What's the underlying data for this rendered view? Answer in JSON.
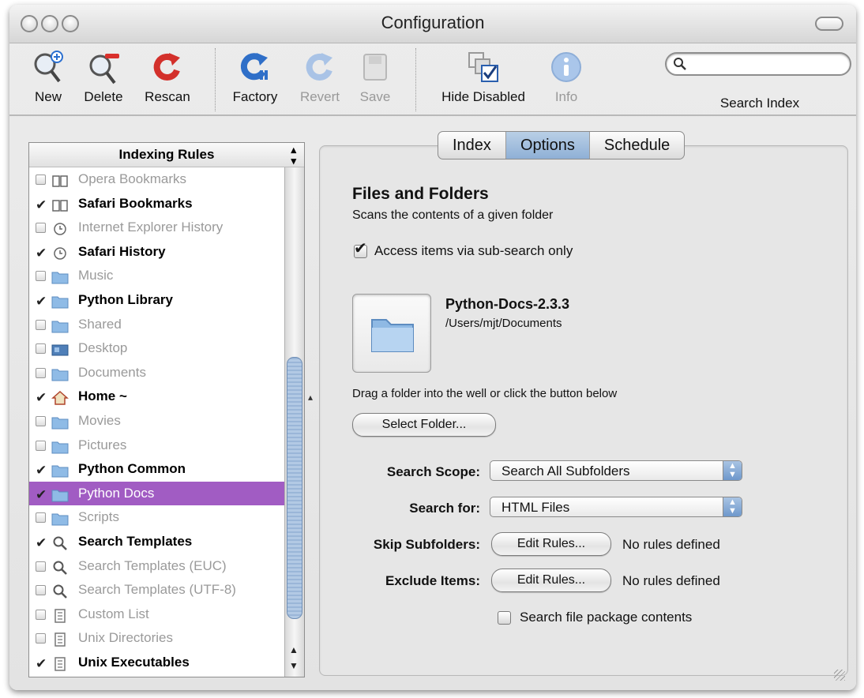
{
  "window": {
    "title": "Configuration"
  },
  "toolbar": {
    "new_label": "New",
    "delete_label": "Delete",
    "rescan_label": "Rescan",
    "factory_label": "Factory",
    "revert_label": "Revert",
    "save_label": "Save",
    "hide_disabled_label": "Hide Disabled",
    "info_label": "Info",
    "search_label": "Search Index",
    "search_value": ""
  },
  "sidebar": {
    "header": "Indexing Rules",
    "items": [
      {
        "label": "Opera Bookmarks",
        "checked": false,
        "icon": "book-icon"
      },
      {
        "label": "Safari Bookmarks",
        "checked": true,
        "icon": "book-icon"
      },
      {
        "label": "Internet Explorer History",
        "checked": false,
        "icon": "clock-icon"
      },
      {
        "label": "Safari History",
        "checked": true,
        "icon": "clock-icon"
      },
      {
        "label": "Music",
        "checked": false,
        "icon": "folder-icon"
      },
      {
        "label": "Python Library",
        "checked": true,
        "icon": "folder-icon"
      },
      {
        "label": "Shared",
        "checked": false,
        "icon": "folder-icon"
      },
      {
        "label": "Desktop",
        "checked": false,
        "icon": "desktop-icon"
      },
      {
        "label": "Documents",
        "checked": false,
        "icon": "folder-icon"
      },
      {
        "label": "Home ~",
        "checked": true,
        "icon": "home-icon"
      },
      {
        "label": "Movies",
        "checked": false,
        "icon": "folder-icon"
      },
      {
        "label": "Pictures",
        "checked": false,
        "icon": "folder-icon"
      },
      {
        "label": "Python Common",
        "checked": true,
        "icon": "folder-icon"
      },
      {
        "label": "Python Docs",
        "checked": true,
        "icon": "folder-icon",
        "selected": true
      },
      {
        "label": "Scripts",
        "checked": false,
        "icon": "folder-icon"
      },
      {
        "label": "Search Templates",
        "checked": true,
        "icon": "magnifier-icon"
      },
      {
        "label": "Search Templates (EUC)",
        "checked": false,
        "icon": "magnifier-icon"
      },
      {
        "label": "Search Templates (UTF-8)",
        "checked": false,
        "icon": "magnifier-icon"
      },
      {
        "label": "Custom List",
        "checked": false,
        "icon": "list-icon"
      },
      {
        "label": "Unix Directories",
        "checked": false,
        "icon": "list-icon"
      },
      {
        "label": "Unix Executables",
        "checked": true,
        "icon": "list-icon"
      }
    ]
  },
  "tabs": [
    {
      "label": "Index",
      "active": false
    },
    {
      "label": "Options",
      "active": true
    },
    {
      "label": "Schedule",
      "active": false
    }
  ],
  "options": {
    "heading": "Files and Folders",
    "description": "Scans the contents of a given folder",
    "sub_search_label": "Access items via sub-search only",
    "sub_search_checked": true,
    "folder_name": "Python-Docs-2.3.3",
    "folder_path": "/Users/mjt/Documents",
    "drag_hint": "Drag a folder into the well or click the button below",
    "select_folder_label": "Select Folder...",
    "search_scope_label": "Search Scope:",
    "search_scope_value": "Search All Subfolders",
    "search_for_label": "Search for:",
    "search_for_value": "HTML Files",
    "skip_subfolders_label": "Skip Subfolders:",
    "skip_edit_label": "Edit Rules...",
    "skip_status": "No rules defined",
    "exclude_items_label": "Exclude Items:",
    "exclude_edit_label": "Edit Rules...",
    "exclude_status": "No rules defined",
    "package_contents_label": "Search file package contents",
    "package_contents_checked": false
  }
}
